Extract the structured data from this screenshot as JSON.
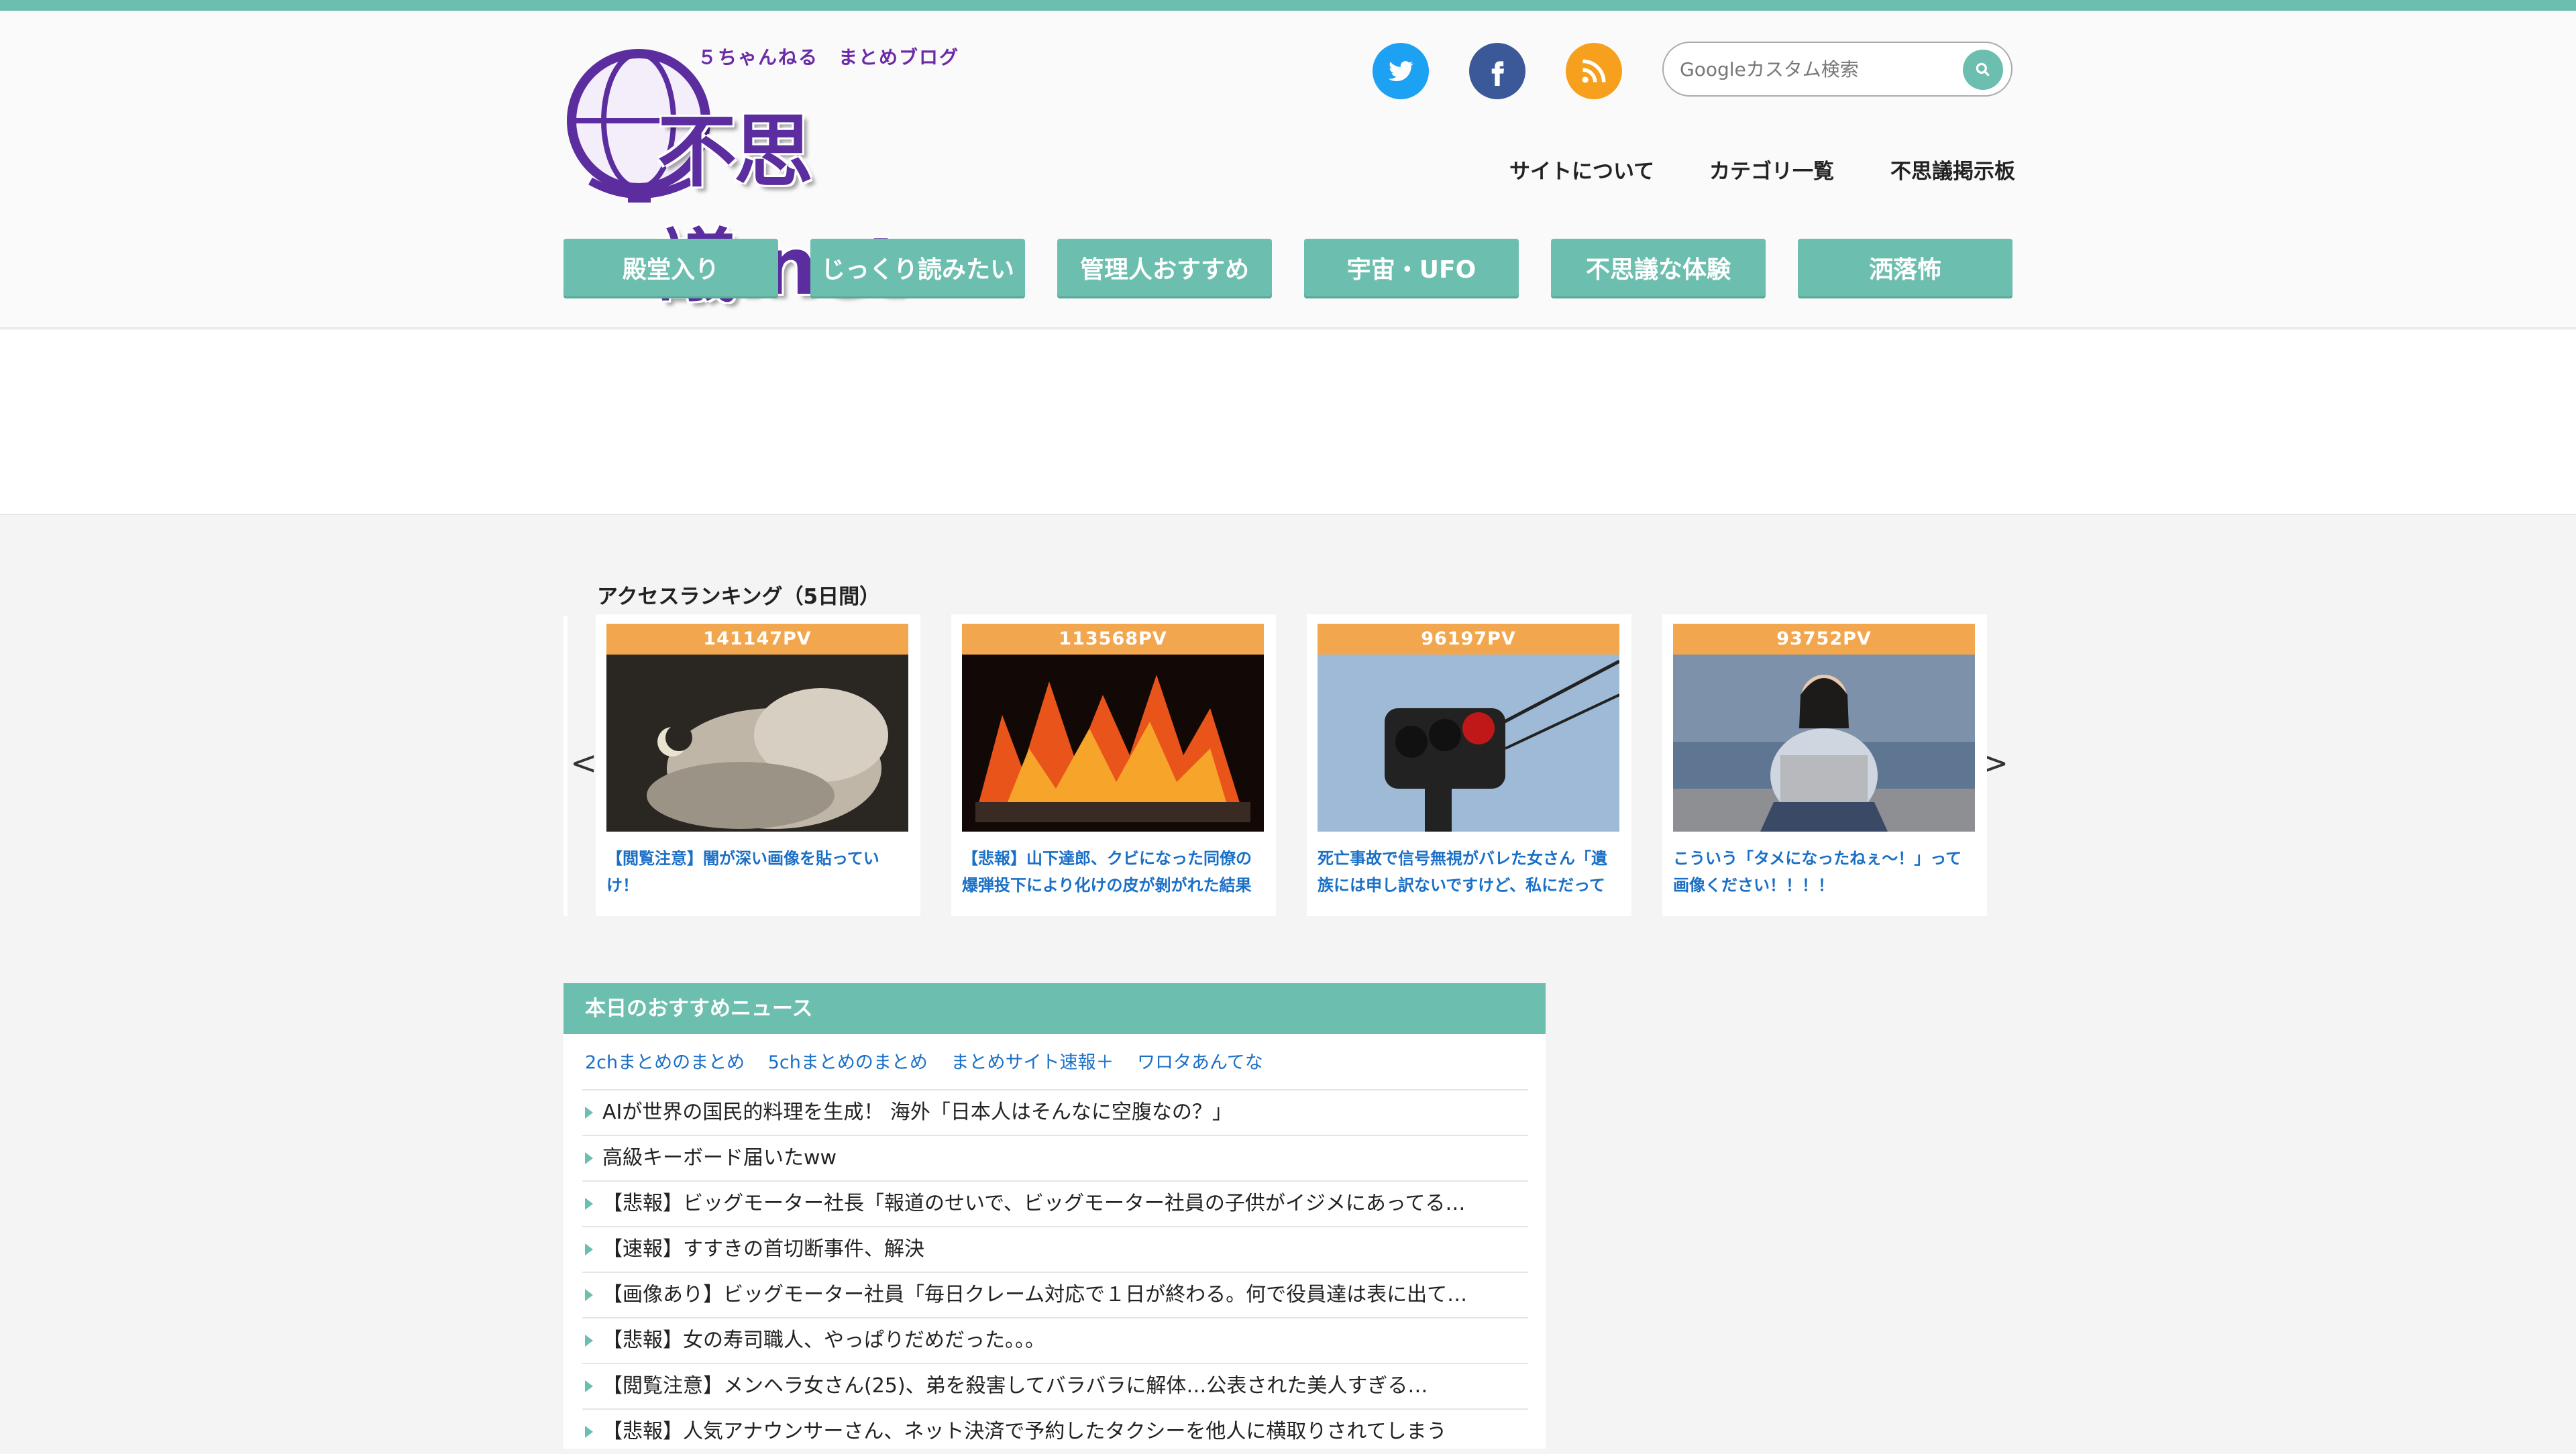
{
  "logo": {
    "tagline": "５ちゃんねる　まとめブログ",
    "name": "不思議.net"
  },
  "social": [
    "twitter-icon",
    "facebook-icon",
    "rss-icon"
  ],
  "search": {
    "placeholder": "Googleカスタム検索"
  },
  "subnav": [
    "サイトについて",
    "カテゴリ一覧",
    "不思議掲示板"
  ],
  "categories": [
    "殿堂入り",
    "じっくり読みたい",
    "管理人おすすめ",
    "宇宙・UFO",
    "不思議な体験",
    "洒落怖"
  ],
  "ranking": {
    "title": "アクセスランキング（5日間）",
    "prev": "<",
    "next": ">",
    "items": [
      {
        "pv": "141147PV",
        "title": "【閲覧注意】闇が深い画像を貼っていけ！"
      },
      {
        "pv": "113568PV",
        "title": "【悲報】山下達郎、クビになった同僚の爆弾投下により化けの皮が剝がれた結果"
      },
      {
        "pv": "96197PV",
        "title": "死亡事故で信号無視がバレた女さん「遺族には申し訳ないですけど、私にだって"
      },
      {
        "pv": "93752PV",
        "title": "こういう「タメになったねぇ～！」って画像ください！！！！"
      }
    ]
  },
  "news": {
    "title": "本日のおすすめニュース",
    "links": [
      "2chまとめのまとめ",
      "5chまとめのまとめ",
      "まとめサイト速報＋",
      "ワロタあんてな"
    ],
    "items": [
      "AIが世界の国民的料理を生成！ 海外「日本人はそんなに空腹なの？」",
      "高級キーボード届いたww",
      "【悲報】ビッグモーター社長「報道のせいで、ビッグモーター社員の子供がイジメにあってる…",
      "【速報】すすきの首切断事件、解決",
      "【画像あり】ビッグモーター社員「毎日クレーム対応で１日が終わる。何で役員達は表に出て…",
      "【悲報】女の寿司職人、やっぱりだめだった。。。",
      "【閲覧注意】メンヘラ女さん(25)、弟を殺害してバラバラに解体…公表された美人すぎる…",
      "【悲報】人気アナウンサーさん、ネット決済で予約したタクシーを他人に横取りされてしまう"
    ]
  },
  "colors": {
    "accent": "#6cbfae",
    "pv_badge": "#f2a74e",
    "link": "#1a6fc6",
    "logo": "#5b2d9e"
  }
}
